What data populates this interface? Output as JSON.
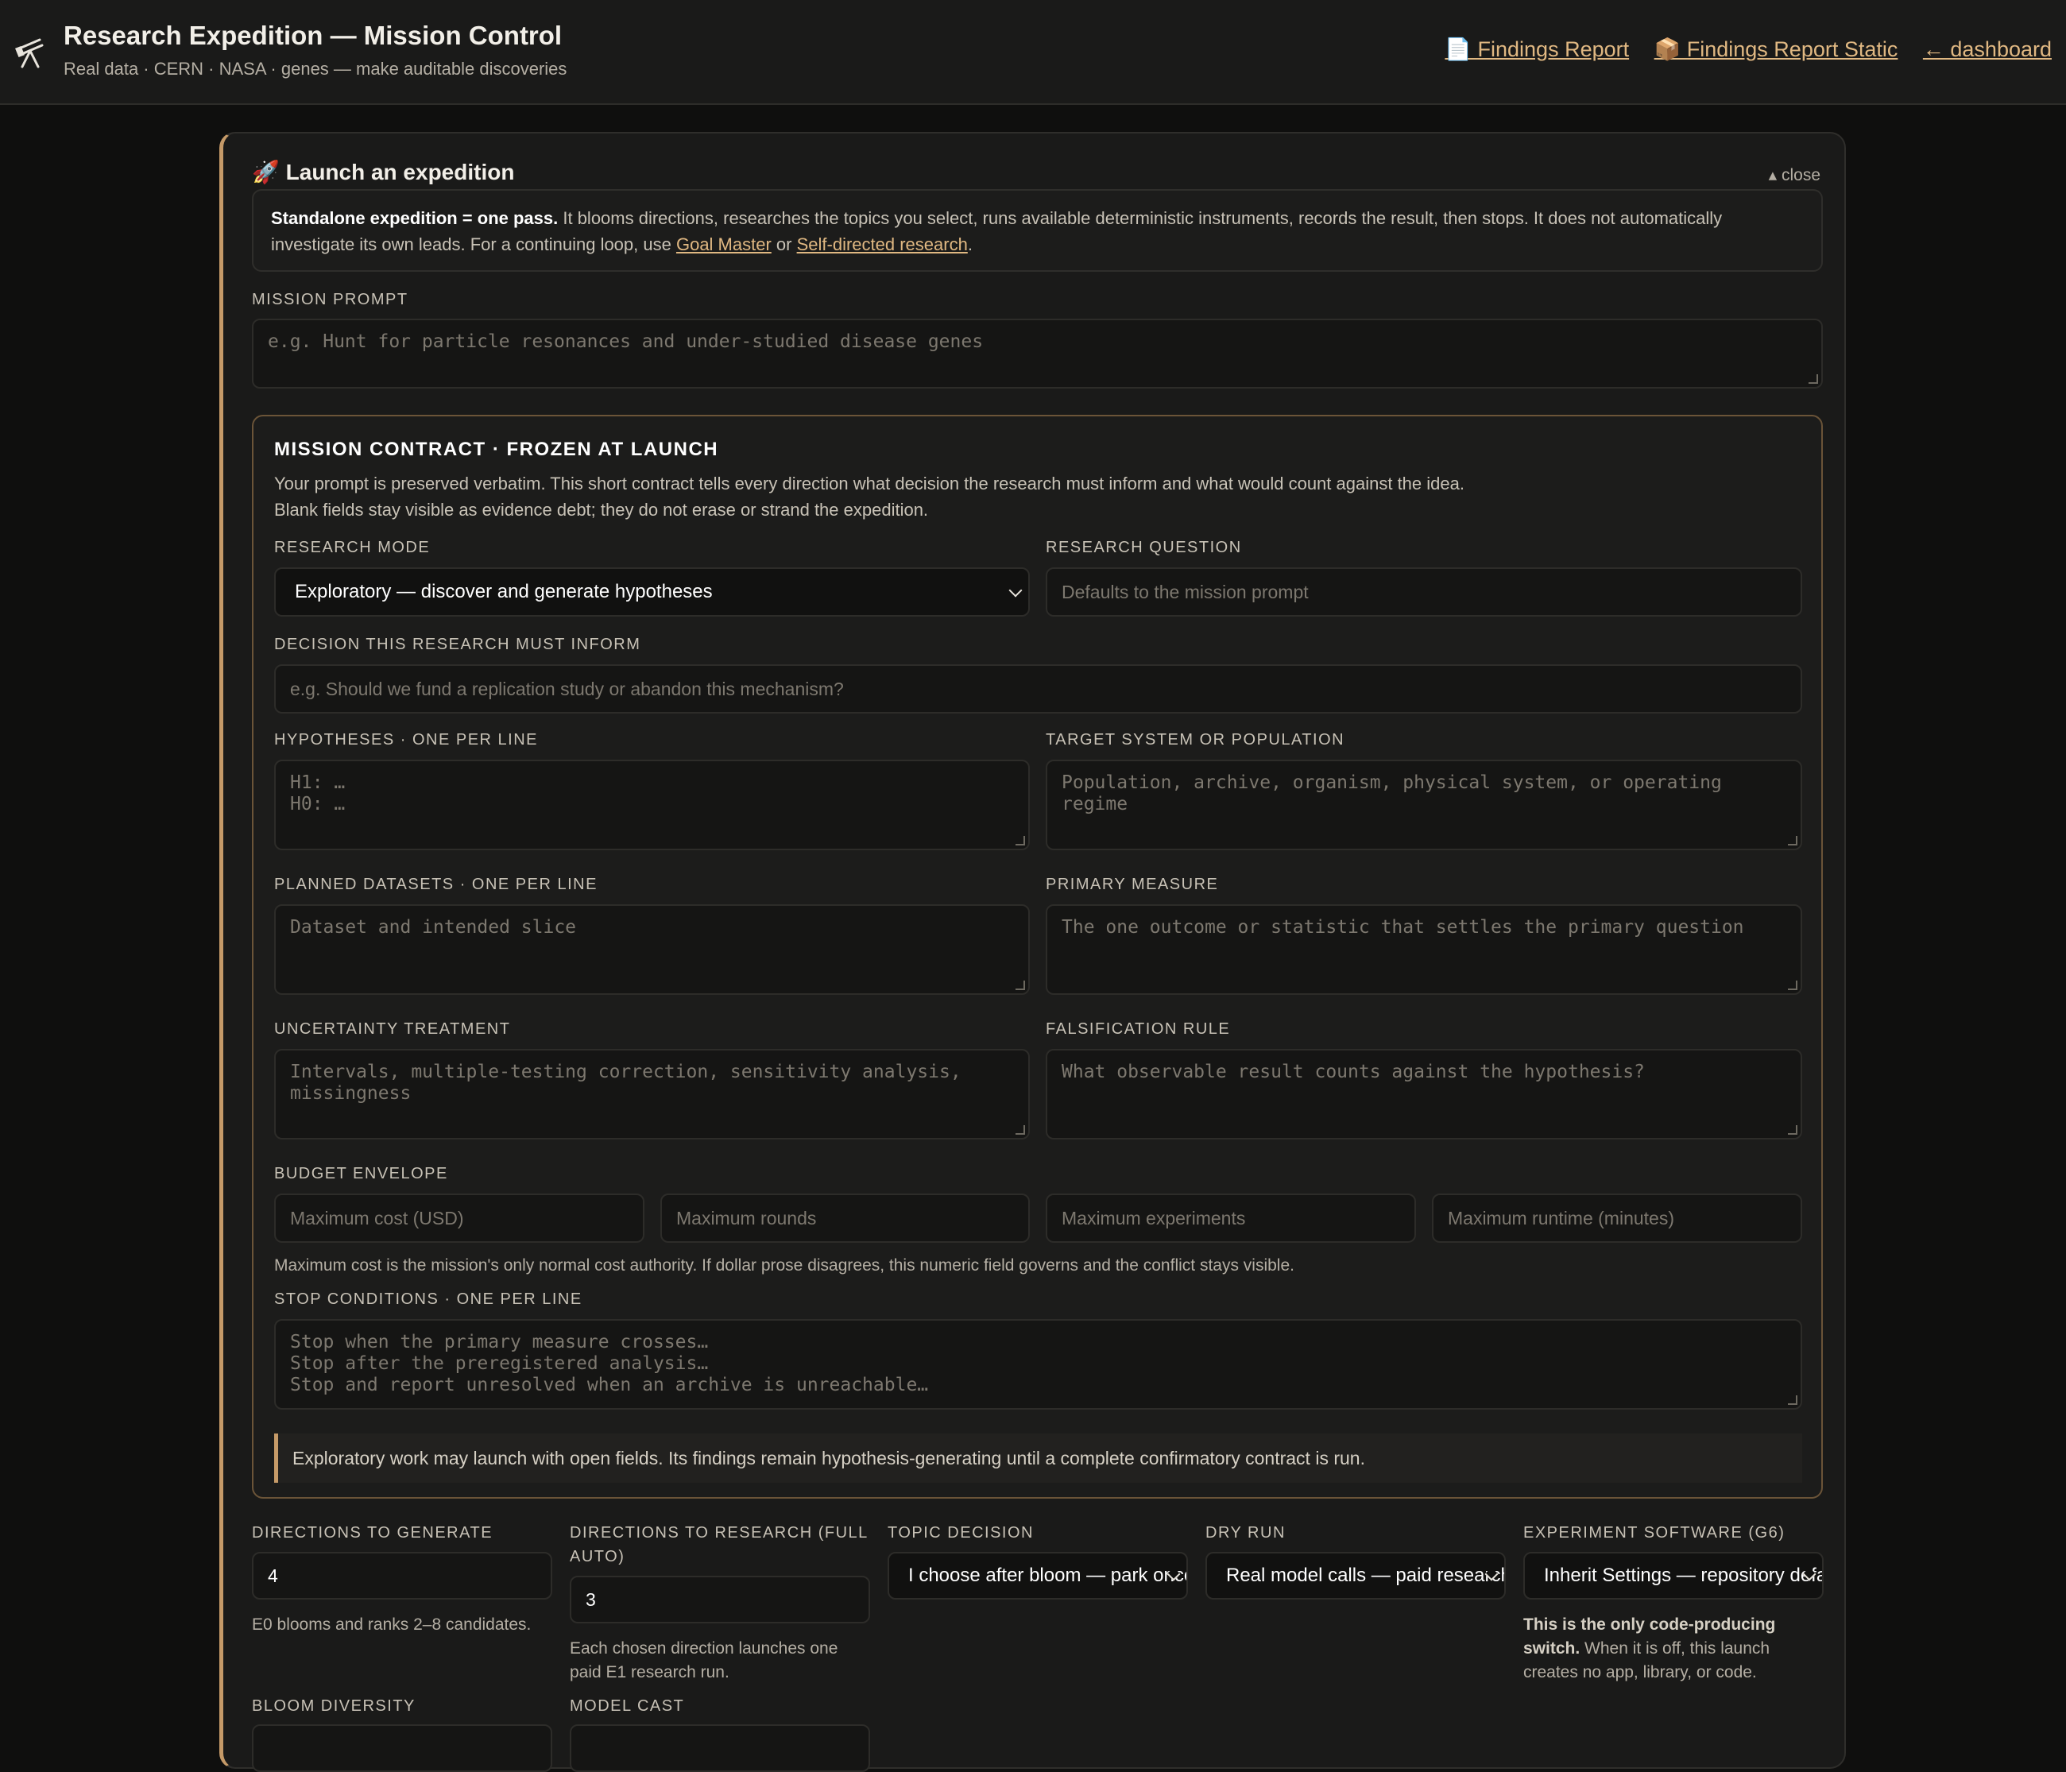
{
  "header": {
    "title": "Research Expedition — Mission Control",
    "subtitle": "Real data · CERN · NASA · genes — make auditable discoveries",
    "logo_icon": "telescope-icon",
    "links": [
      {
        "label": "📄 Findings Report"
      },
      {
        "label": "📦 Findings Report Static"
      },
      {
        "label": "← dashboard"
      }
    ]
  },
  "launch": {
    "heading": "🚀 Launch an expedition",
    "close_label": "▴ close",
    "note": {
      "bold": "Standalone expedition = one pass.",
      "text": " It blooms directions, researches the topics you select, runs available deterministic instruments, records the result, then stops. It does not automatically investigate its own leads. For a continuing loop, use ",
      "link1": "Goal Master",
      "or": " or ",
      "link2": "Self-directed research",
      "end": "."
    },
    "mission_prompt": {
      "label": "MISSION PROMPT",
      "placeholder": "e.g. Hunt for particle resonances and under-studied disease genes"
    }
  },
  "contract": {
    "title": "MISSION CONTRACT · FROZEN AT LAUNCH",
    "desc1": "Your prompt is preserved verbatim. This short contract tells every direction what decision the research must inform and what would count against the idea.",
    "desc2": "Blank fields stay visible as evidence debt; they do not erase or strand the expedition.",
    "research_mode": {
      "label": "RESEARCH MODE",
      "value": "Exploratory — discover and generate hypotheses"
    },
    "research_question": {
      "label": "RESEARCH QUESTION",
      "placeholder": "Defaults to the mission prompt"
    },
    "decision": {
      "label": "DECISION THIS RESEARCH MUST INFORM",
      "placeholder": "e.g. Should we fund a replication study or abandon this mechanism?"
    },
    "hypotheses": {
      "label": "HYPOTHESES · ONE PER LINE",
      "placeholder": "H1: …\nH0: …"
    },
    "target": {
      "label": "TARGET SYSTEM OR POPULATION",
      "placeholder": "Population, archive, organism, physical system, or operating regime"
    },
    "datasets": {
      "label": "PLANNED DATASETS · ONE PER LINE",
      "placeholder": "Dataset and intended slice"
    },
    "primary_measure": {
      "label": "PRIMARY MEASURE",
      "placeholder": "The one outcome or statistic that settles the primary question"
    },
    "uncertainty": {
      "label": "UNCERTAINTY TREATMENT",
      "placeholder": "Intervals, multiple-testing correction, sensitivity analysis, missingness"
    },
    "falsification": {
      "label": "FALSIFICATION RULE",
      "placeholder": "What observable result counts against the hypothesis?"
    },
    "budget": {
      "label": "BUDGET ENVELOPE",
      "cost": "Maximum cost (USD)",
      "rounds": "Maximum rounds",
      "experiments": "Maximum experiments",
      "runtime": "Maximum runtime (minutes)",
      "hint": "Maximum cost is the mission's only normal cost authority. If dollar prose disagrees, this numeric field governs and the conflict stays visible."
    },
    "stop": {
      "label": "STOP CONDITIONS · ONE PER LINE",
      "placeholder": "Stop when the primary measure crosses…\nStop after the preregistered analysis…\nStop and report unresolved when an archive is unreachable…"
    },
    "callout": "Exploratory work may launch with open fields. Its findings remain hypothesis-generating until a complete confirmatory contract is run."
  },
  "settings": {
    "directions_generate": {
      "label": "DIRECTIONS TO GENERATE",
      "value": "4",
      "hint": "E0 blooms and ranks 2–8 candidates."
    },
    "directions_research": {
      "label1": "DIRECTIONS TO RESEARCH (FULL",
      "label2": "AUTO)",
      "value": "3",
      "hint1": "Each chosen direction launches one",
      "hint2": "paid E1 research run."
    },
    "topic_decision": {
      "label": "TOPIC DECISION",
      "value": "I choose after bloom — park once"
    },
    "dry_run": {
      "label": "DRY RUN",
      "value": "Real model calls — paid research"
    },
    "experiment_software": {
      "label": "EXPERIMENT SOFTWARE (G6)",
      "value": "Inherit Settings — repository default",
      "hint_bold1": "This is the only code-producing",
      "hint_bold2": "switch.",
      "hint2": " When it is off, this launch",
      "hint3": "creates no app, library, or code."
    },
    "bloom_diversity": {
      "label": "BLOOM DIVERSITY"
    },
    "model_cast": {
      "label": "MODEL CAST"
    }
  }
}
